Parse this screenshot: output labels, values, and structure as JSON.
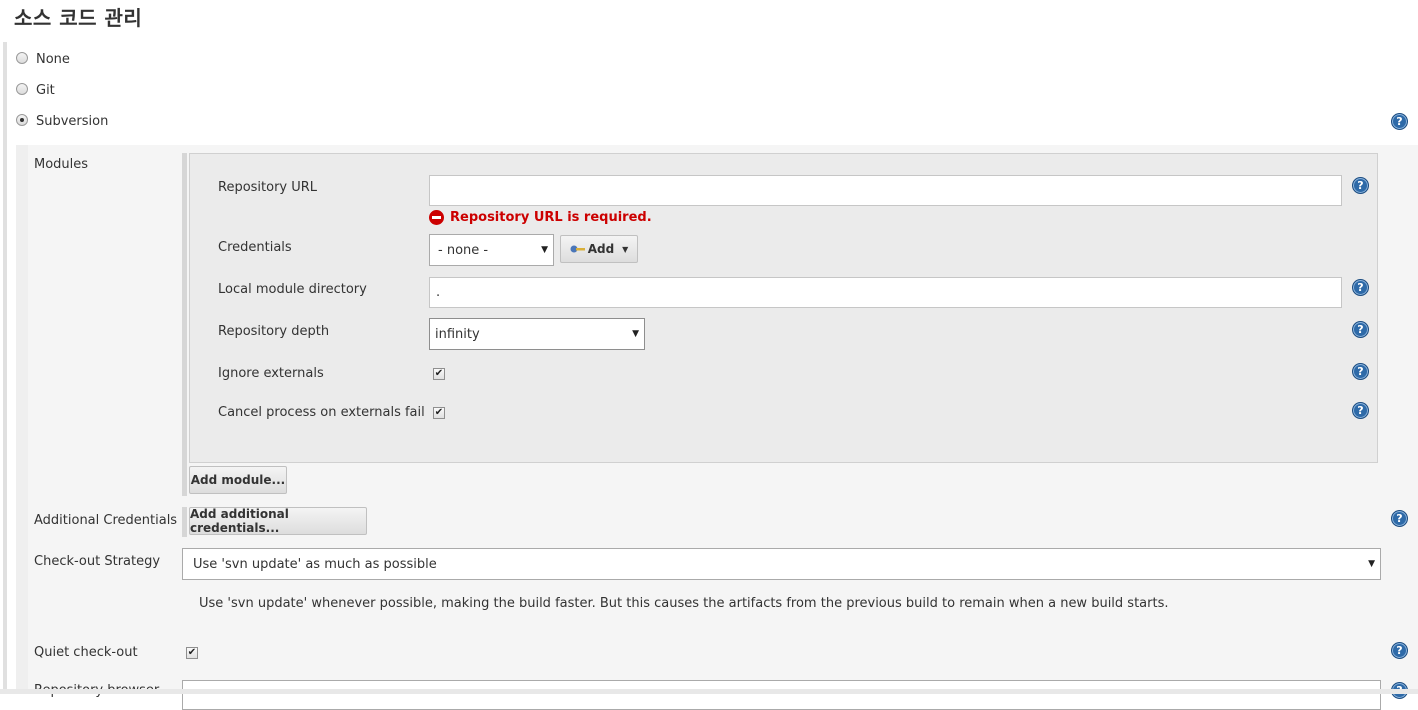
{
  "page_title": "소스 코드 관리",
  "scm_options": [
    {
      "label": "None",
      "checked": false
    },
    {
      "label": "Git",
      "checked": false
    },
    {
      "label": "Subversion",
      "checked": true
    }
  ],
  "modules": {
    "label": "Modules",
    "repository_url": {
      "label": "Repository URL",
      "value": "",
      "error": "Repository URL is required."
    },
    "credentials": {
      "label": "Credentials",
      "selected": "- none -",
      "add_label": "Add"
    },
    "local_module_directory": {
      "label": "Local module directory",
      "value": "."
    },
    "repository_depth": {
      "label": "Repository depth",
      "selected": "infinity"
    },
    "ignore_externals": {
      "label": "Ignore externals",
      "checked": true
    },
    "cancel_process": {
      "label": "Cancel process on externals fail",
      "checked": true
    },
    "add_module_label": "Add module..."
  },
  "additional_credentials": {
    "label": "Additional Credentials",
    "button_label": "Add additional credentials..."
  },
  "checkout_strategy": {
    "label": "Check-out Strategy",
    "selected": "Use 'svn update' as much as possible",
    "description": "Use 'svn update' whenever possible, making the build faster. But this causes the artifacts from the previous build to remain when a new build starts."
  },
  "quiet_checkout": {
    "label": "Quiet check-out",
    "checked": true
  },
  "repository_browser": {
    "label": "Repository browser"
  },
  "icons": {
    "help": "help-icon",
    "error": "error-icon",
    "key": "key-icon",
    "dropdown": "chevron-down-icon"
  },
  "colors": {
    "error": "#cc0000",
    "help": "#2e6aa8",
    "panel": "#f5f5f5",
    "module_box": "#ebebeb"
  }
}
